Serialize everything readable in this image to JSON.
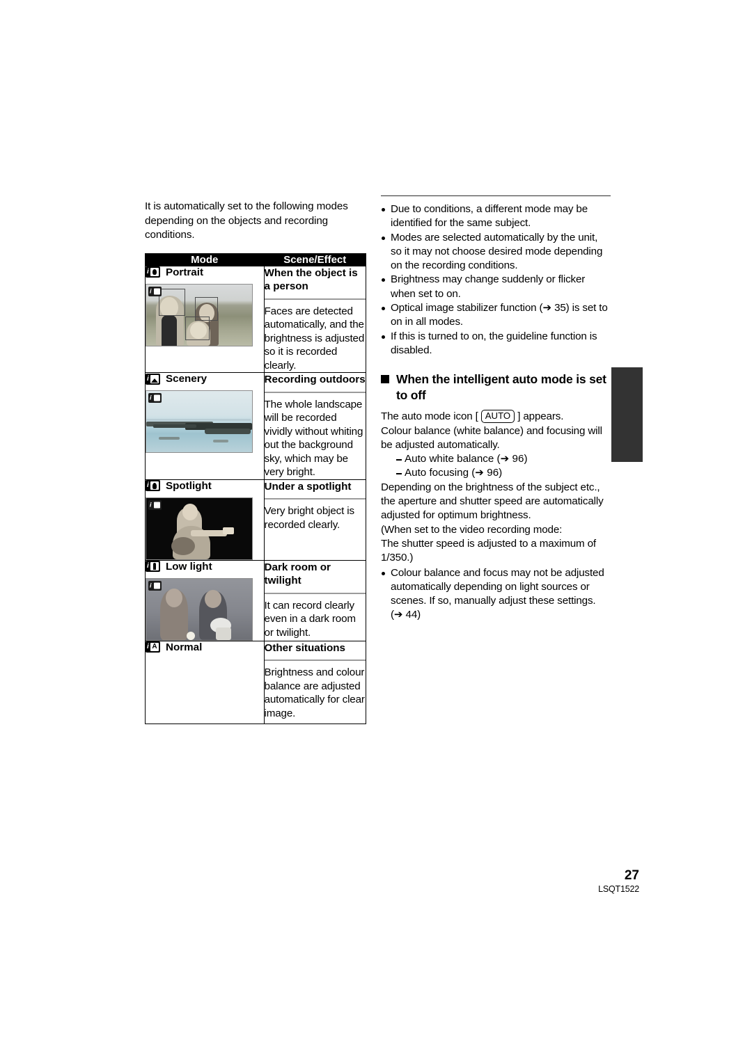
{
  "left": {
    "intro": "It is automatically set to the following modes depending on the objects and recording conditions.",
    "table": {
      "headers": [
        "Mode",
        "Scene/Effect"
      ],
      "rows": [
        {
          "icon": "portrait-mode-icon",
          "mode": "Portrait",
          "thumb_osd": "portrait-osd-icon",
          "effect_head": "When the object is a person",
          "effect_body": "Faces are detected automatically, and the brightness is adjusted so it is recorded clearly."
        },
        {
          "icon": "scenery-mode-icon",
          "mode": "Scenery",
          "thumb_osd": "scenery-osd-icon",
          "effect_head": "Recording outdoors",
          "effect_body": "The whole landscape will be recorded vividly without whiting out the background sky, which may be very bright."
        },
        {
          "icon": "spotlight-mode-icon",
          "mode": "Spotlight",
          "thumb_osd": "spotlight-osd-icon",
          "effect_head": "Under a spotlight",
          "effect_body": "Very bright object is recorded clearly."
        },
        {
          "icon": "low-light-mode-icon",
          "mode": "Low light",
          "thumb_osd": "low-light-osd-icon",
          "effect_head": "Dark room or twilight",
          "effect_body": "It can record clearly even in a dark room or twilight."
        },
        {
          "icon": "normal-mode-icon",
          "mode": "Normal",
          "thumb_osd": "",
          "effect_head": "Other situations",
          "effect_body": "Brightness and colour balance are adjusted automatically for clear image."
        }
      ]
    }
  },
  "right": {
    "bullets": [
      "Due to conditions, a different mode may be identified for the same subject.",
      "Modes are selected automatically by the unit, so it may not choose desired mode depending on the recording conditions.",
      "Brightness may change suddenly or flicker when set to on.",
      "Optical image stabilizer function (➔ 35) is set to on in all modes.",
      "If this is turned to on, the guideline function is disabled."
    ],
    "section_heading": "When the intelligent auto mode is set to off",
    "para1_before": "The auto mode icon [ ",
    "auto_chip": "AUTO",
    "para1_after": " ] appears.",
    "para2": "Colour balance (white balance) and focusing will be adjusted automatically.",
    "dash_items": [
      "Auto white balance (➔ 96)",
      "Auto focusing (➔ 96)"
    ],
    "para3": "Depending on the brightness of the subject etc., the aperture and shutter speed are automatically adjusted for optimum brightness.",
    "para4": "(When set to the video recording mode:",
    "para5": "The shutter speed is adjusted to a maximum of 1/350.)",
    "final_bullet": "Colour balance and focus may not be adjusted automatically depending on light sources or scenes. If so, manually adjust these settings. (➔ 44)"
  },
  "footer": {
    "page_number": "27",
    "doc_code": "LSQT1522"
  },
  "colors": {
    "header_bg": "#000000",
    "header_text": "#ffffff",
    "rule": "#9b9b9b",
    "side_tab": "#333333"
  }
}
